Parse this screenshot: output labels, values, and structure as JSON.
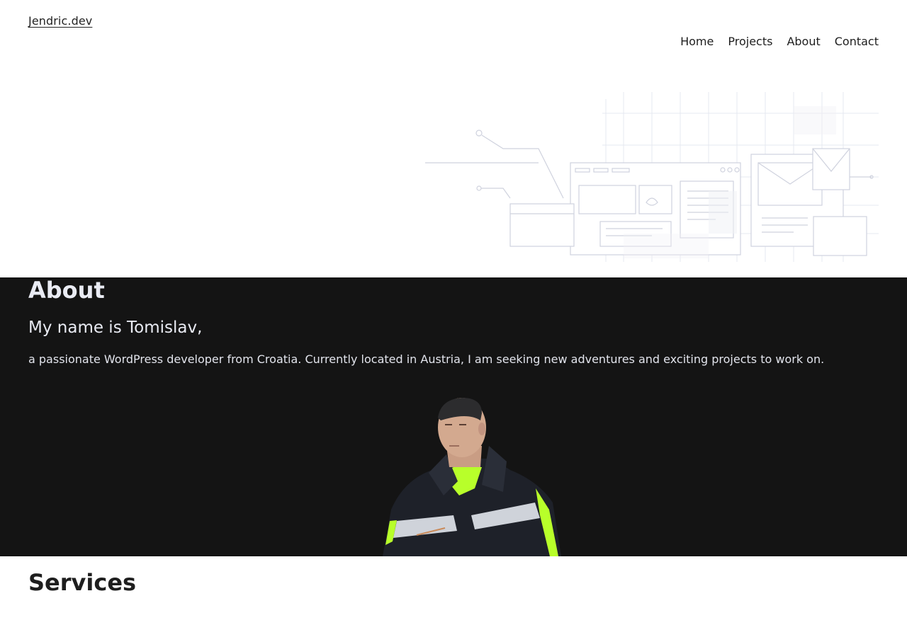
{
  "header": {
    "logo": "Jendric.dev",
    "nav": [
      "Home",
      "Projects",
      "About",
      "Contact"
    ]
  },
  "about": {
    "heading": "About",
    "intro": "My name is Tomislav,",
    "text": "a passionate WordPress developer from Croatia. Currently located in Austria, I am seeking new adventures and exciting projects to work on."
  },
  "services": {
    "heading": "Services"
  },
  "colors": {
    "about_bg": "#141414",
    "jacket_accent": "#b8ff2a"
  }
}
